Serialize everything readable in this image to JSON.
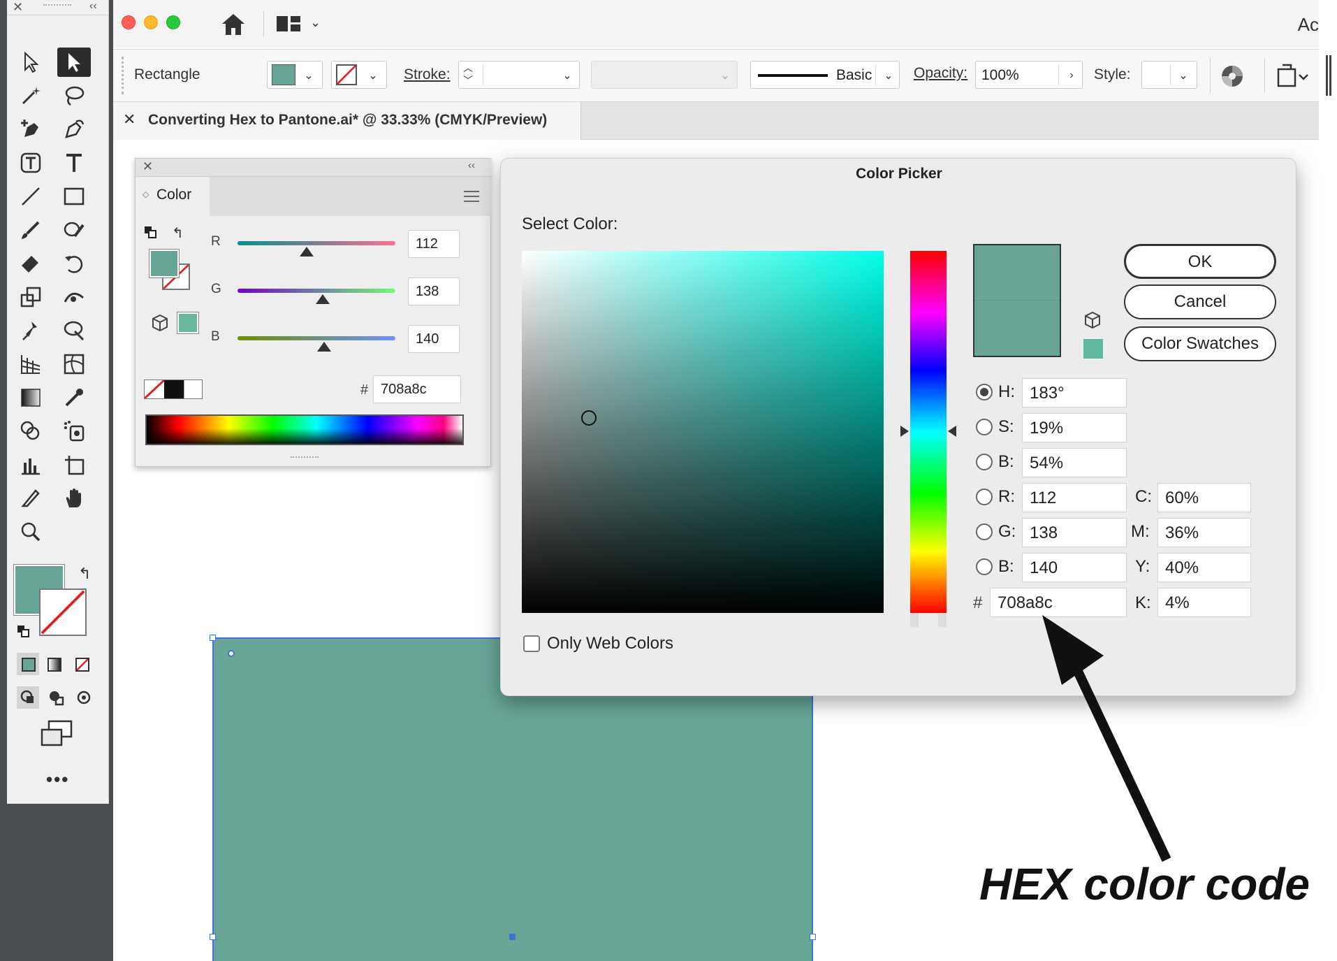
{
  "app": {
    "title_partial": "Ac",
    "colors": {
      "fill": "#68a597",
      "selection": "#3d73d8",
      "panel_bg": "#f0f0f0"
    }
  },
  "control_bar": {
    "object_type": "Rectangle",
    "stroke_label": "Stroke:",
    "brush_label": "Basic",
    "opacity_label": "Opacity:",
    "opacity_value": "100%",
    "style_label": "Style:"
  },
  "document_tab": {
    "title": "Converting Hex to Pantone.ai* @ 33.33% (CMYK/Preview)"
  },
  "color_panel": {
    "tab_label": "Color",
    "r_label": "R",
    "r_value": "112",
    "r_level": 0.44,
    "g_label": "G",
    "g_value": "138",
    "g_level": 0.54,
    "b_label": "B",
    "b_value": "140",
    "b_level": 0.55,
    "hex_symbol": "#",
    "hex_value": "708a8c"
  },
  "color_picker": {
    "title": "Color Picker",
    "select_label": "Select Color:",
    "ok_label": "OK",
    "cancel_label": "Cancel",
    "swatches_label": "Color Swatches",
    "only_web_label": "Only Web Colors",
    "h_label": "H:",
    "h_value": "183°",
    "s_label": "S:",
    "s_value": "19%",
    "b_label": "B:",
    "b_value": "54%",
    "r_label": "R:",
    "r_value": "112",
    "g_label": "G:",
    "g_value": "138",
    "bb_label": "B:",
    "bb_value": "140",
    "c_label": "C:",
    "c_value": "60%",
    "m_label": "M:",
    "m_value": "36%",
    "y_label": "Y:",
    "y_value": "40%",
    "k_label": "K:",
    "k_value": "4%",
    "hex_symbol": "#",
    "hex_value": "708a8c"
  },
  "annotation": {
    "text": "HEX color code"
  }
}
